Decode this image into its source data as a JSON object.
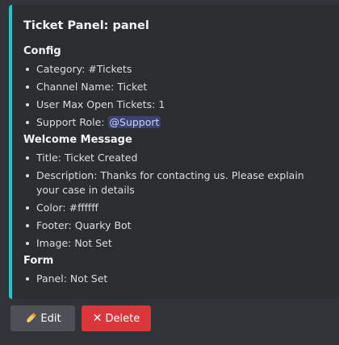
{
  "embed": {
    "accent_color": "#1fc8d0",
    "title": "Ticket Panel: panel",
    "sections": [
      {
        "title": "Config",
        "items": [
          {
            "text": "Category: #Tickets"
          },
          {
            "text": "Channel Name: Ticket"
          },
          {
            "text": "User Max Open Tickets: 1"
          },
          {
            "text": "Support Role: ",
            "mention": "@Support"
          }
        ]
      },
      {
        "title": "Welcome Message",
        "items": [
          {
            "text": "Title: Ticket Created"
          },
          {
            "text": "Description: Thanks for contacting us. Please explain your case in details"
          },
          {
            "text": "Color: #ffffff"
          },
          {
            "text": "Footer: Quarky Bot"
          },
          {
            "text": "Image: Not Set"
          }
        ]
      },
      {
        "title": "Form",
        "items": [
          {
            "text": "Panel: Not Set"
          }
        ]
      }
    ]
  },
  "buttons": {
    "edit": {
      "label": "Edit",
      "icon": "pencil-icon",
      "color": "#4e5058"
    },
    "delete": {
      "label": "Delete",
      "icon": "x-icon",
      "color": "#da373c"
    }
  }
}
